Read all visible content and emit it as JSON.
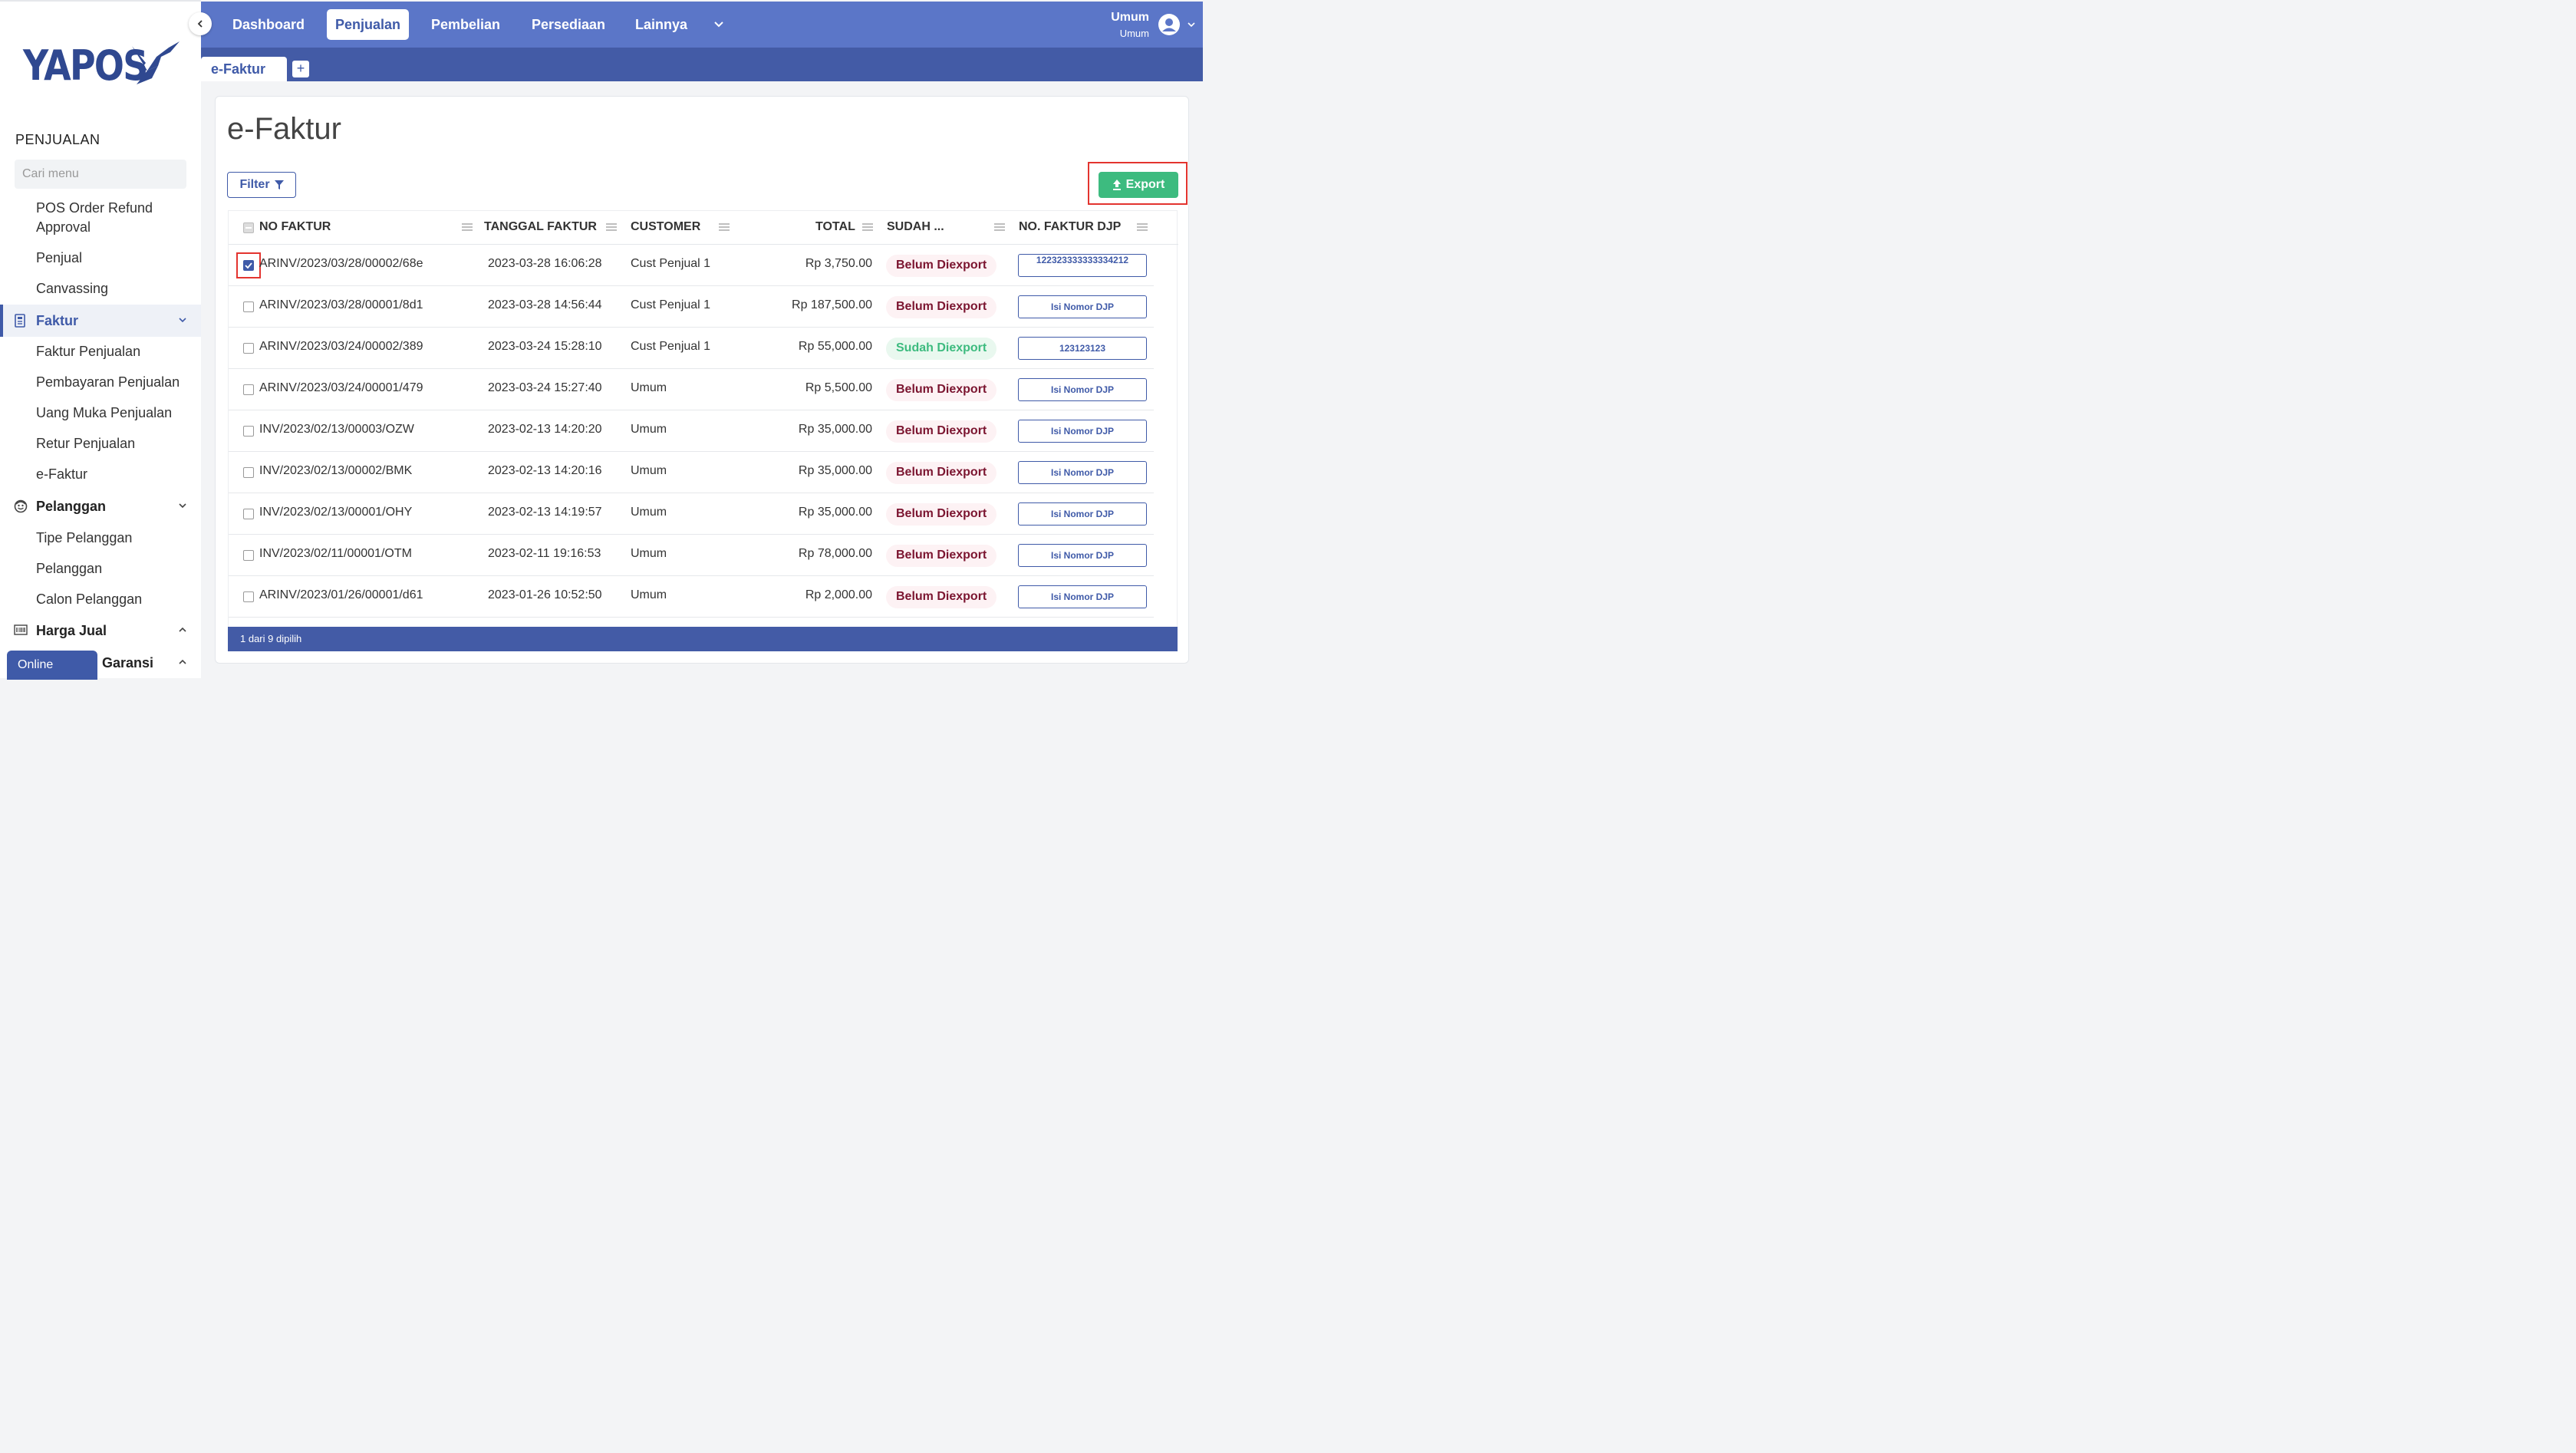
{
  "brand": {
    "name": "YAPOS"
  },
  "sidebar": {
    "section_title": "PENJUALAN",
    "search_placeholder": "Cari menu",
    "items": {
      "pos_refund_1": "POS Order Refund",
      "pos_refund_2": "Approval",
      "penjual": "Penjual",
      "canvassing": "Canvassing",
      "faktur": "Faktur",
      "faktur_penjualan": "Faktur Penjualan",
      "pembayaran_penjualan": "Pembayaran Penjualan",
      "uang_muka": "Uang Muka Penjualan",
      "retur": "Retur Penjualan",
      "efaktur": "e-Faktur",
      "pelanggan_group": "Pelanggan",
      "tipe_pelanggan": "Tipe Pelanggan",
      "pelanggan": "Pelanggan",
      "calon_pelanggan": "Calon Pelanggan",
      "harga_jual": "Harga Jual",
      "garansi": "n Garansi"
    },
    "status": "Online"
  },
  "nav": {
    "items": [
      "Dashboard",
      "Penjualan",
      "Pembelian",
      "Persediaan",
      "Lainnya"
    ],
    "active": "Penjualan",
    "user_name": "Umum",
    "user_role": "Umum"
  },
  "tab": {
    "label": "e-Faktur",
    "add": "+"
  },
  "page": {
    "title": "e-Faktur",
    "filter_label": "Filter",
    "export_label": "Export"
  },
  "table": {
    "columns": {
      "no_faktur": "NO FAKTUR",
      "tanggal": "TANGGAL FAKTUR",
      "customer": "CUSTOMER",
      "total": "TOTAL",
      "status": "SUDAH ...",
      "djp": "NO. FAKTUR DJP"
    },
    "rows": [
      {
        "no": "ARINV/2023/03/28/00002/68e",
        "tanggal": "2023-03-28 16:06:28",
        "customer": "Cust Penjual 1",
        "total": "Rp 3,750.00",
        "status": "Belum Diexport",
        "djp": "122323333333334212"
      },
      {
        "no": "ARINV/2023/03/28/00001/8d1",
        "tanggal": "2023-03-28 14:56:44",
        "customer": "Cust Penjual 1",
        "total": "Rp 187,500.00",
        "status": "Belum Diexport",
        "djp": "Isi Nomor DJP"
      },
      {
        "no": "ARINV/2023/03/24/00002/389",
        "tanggal": "2023-03-24 15:28:10",
        "customer": "Cust Penjual 1",
        "total": "Rp 55,000.00",
        "status": "Sudah Diexport",
        "djp": "123123123"
      },
      {
        "no": "ARINV/2023/03/24/00001/479",
        "tanggal": "2023-03-24 15:27:40",
        "customer": "Umum",
        "total": "Rp 5,500.00",
        "status": "Belum Diexport",
        "djp": "Isi Nomor DJP"
      },
      {
        "no": "INV/2023/02/13/00003/OZW",
        "tanggal": "2023-02-13 14:20:20",
        "customer": "Umum",
        "total": "Rp 35,000.00",
        "status": "Belum Diexport",
        "djp": "Isi Nomor DJP"
      },
      {
        "no": "INV/2023/02/13/00002/BMK",
        "tanggal": "2023-02-13 14:20:16",
        "customer": "Umum",
        "total": "Rp 35,000.00",
        "status": "Belum Diexport",
        "djp": "Isi Nomor DJP"
      },
      {
        "no": "INV/2023/02/13/00001/OHY",
        "tanggal": "2023-02-13 14:19:57",
        "customer": "Umum",
        "total": "Rp 35,000.00",
        "status": "Belum Diexport",
        "djp": "Isi Nomor DJP"
      },
      {
        "no": "INV/2023/02/11/00001/OTM",
        "tanggal": "2023-02-11 19:16:53",
        "customer": "Umum",
        "total": "Rp 78,000.00",
        "status": "Belum Diexport",
        "djp": "Isi Nomor DJP"
      },
      {
        "no": "ARINV/2023/01/26/00001/d61",
        "tanggal": "2023-01-26 10:52:50",
        "customer": "Umum",
        "total": "Rp 2,000.00",
        "status": "Belum Diexport",
        "djp": "Isi Nomor DJP"
      }
    ],
    "footer": "1 dari 9 dipilih"
  },
  "colors": {
    "primary": "#3f5aa8",
    "nav": "#5b76c8",
    "success": "#3dbb7f",
    "danger_text": "#7b1530",
    "highlight": "#e3342f"
  }
}
